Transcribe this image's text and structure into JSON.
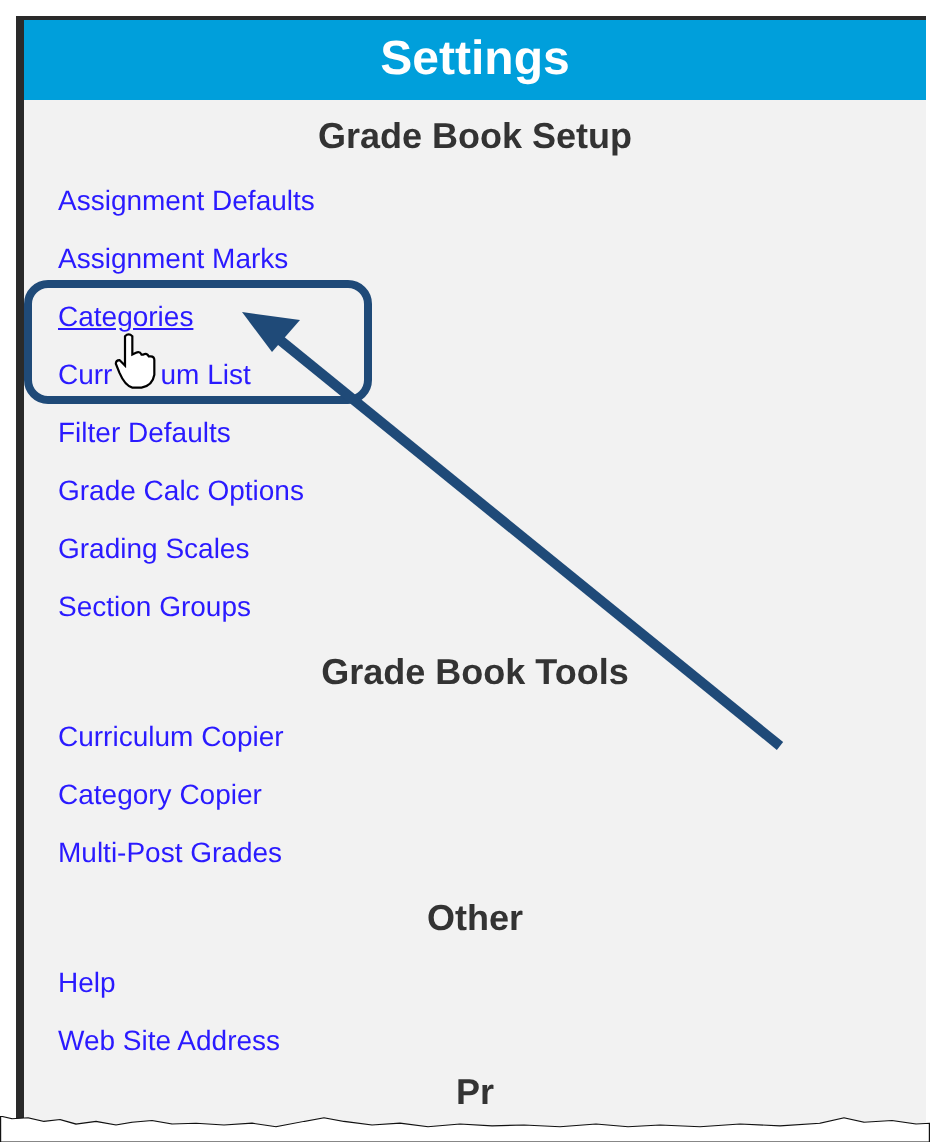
{
  "window": {
    "title": "Settings"
  },
  "sections": [
    {
      "heading": "Grade Book Setup",
      "items": [
        {
          "label": "Assignment Defaults",
          "hovered": false
        },
        {
          "label": "Assignment Marks",
          "hovered": false
        },
        {
          "label": "Categories",
          "hovered": true
        },
        {
          "kind": "under-cursor",
          "parts": [
            "Curr",
            "um List"
          ],
          "hovered": false
        },
        {
          "label": "Filter Defaults",
          "hovered": false
        },
        {
          "label": "Grade Calc Options",
          "hovered": false
        },
        {
          "label": "Grading Scales",
          "hovered": false
        },
        {
          "label": "Section Groups",
          "hovered": false
        }
      ]
    },
    {
      "heading": "Grade Book Tools",
      "items": [
        {
          "label": "Curriculum Copier",
          "hovered": false
        },
        {
          "label": "Category Copier",
          "hovered": false
        },
        {
          "label": "Multi-Post Grades",
          "hovered": false
        }
      ]
    },
    {
      "heading": "Other",
      "items": [
        {
          "label": "Help",
          "hovered": false
        },
        {
          "label": "Web Site Address",
          "hovered": false
        }
      ]
    },
    {
      "heading": "Pr"
    }
  ]
}
